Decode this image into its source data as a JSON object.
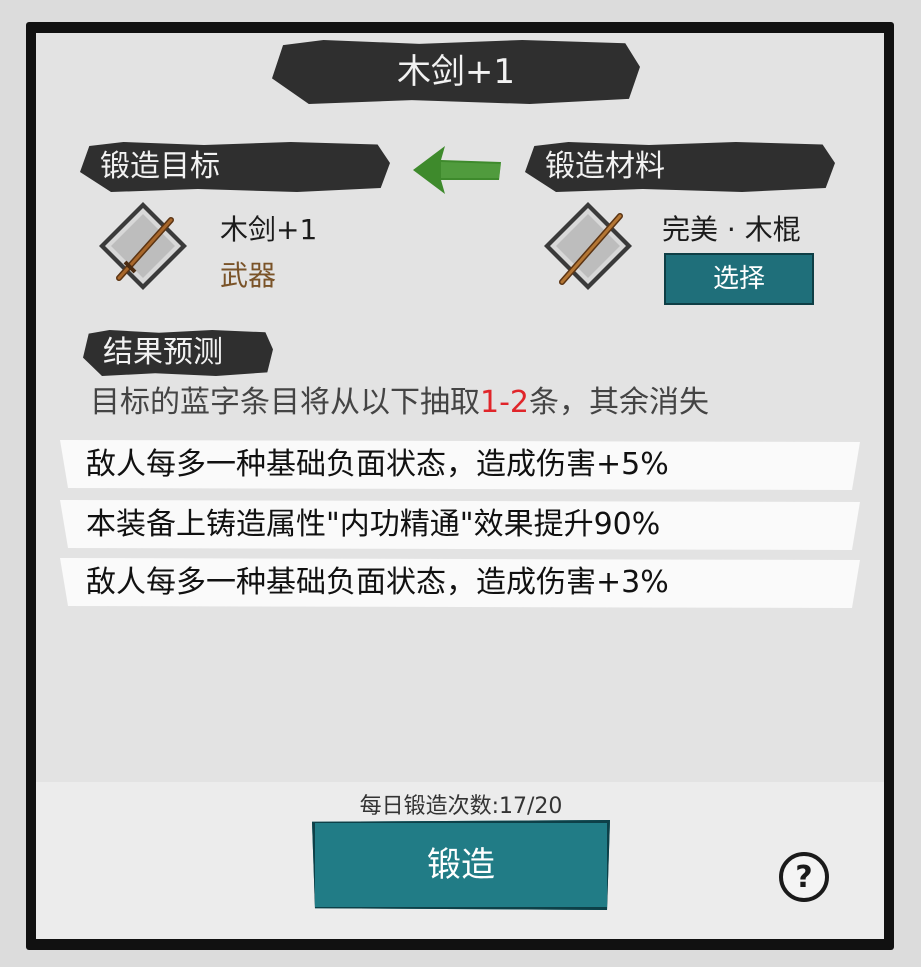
{
  "title": "木剑+1",
  "sections": {
    "target_label": "锻造目标",
    "material_label": "锻造材料",
    "result_label": "结果预测"
  },
  "target": {
    "name": "木剑+1",
    "type": "武器",
    "icon": "wooden-sword-icon"
  },
  "material": {
    "name": "完美 · 木棍",
    "select_label": "选择",
    "icon": "wooden-stick-icon"
  },
  "prediction": {
    "prefix": "目标的蓝字条目将从以下抽取",
    "range": "1-2",
    "suffix": "条，其余消失",
    "effects": [
      "敌人每多一种基础负面状态，造成伤害+5%",
      "本装备上铸造属性\"内功精通\"效果提升90%",
      "敌人每多一种基础负面状态，造成伤害+3%"
    ]
  },
  "footer": {
    "daily_label": "每日锻造次数",
    "daily_count": "17/20",
    "daily_text": "每日锻造次数:17/20",
    "forge_label": "锻造",
    "help_icon": "question-mark-icon"
  },
  "colors": {
    "teal_button": "#217c86",
    "highlight_red": "#e0252a",
    "type_brown": "#7a5328",
    "arrow_green": "#3e8a2c"
  }
}
